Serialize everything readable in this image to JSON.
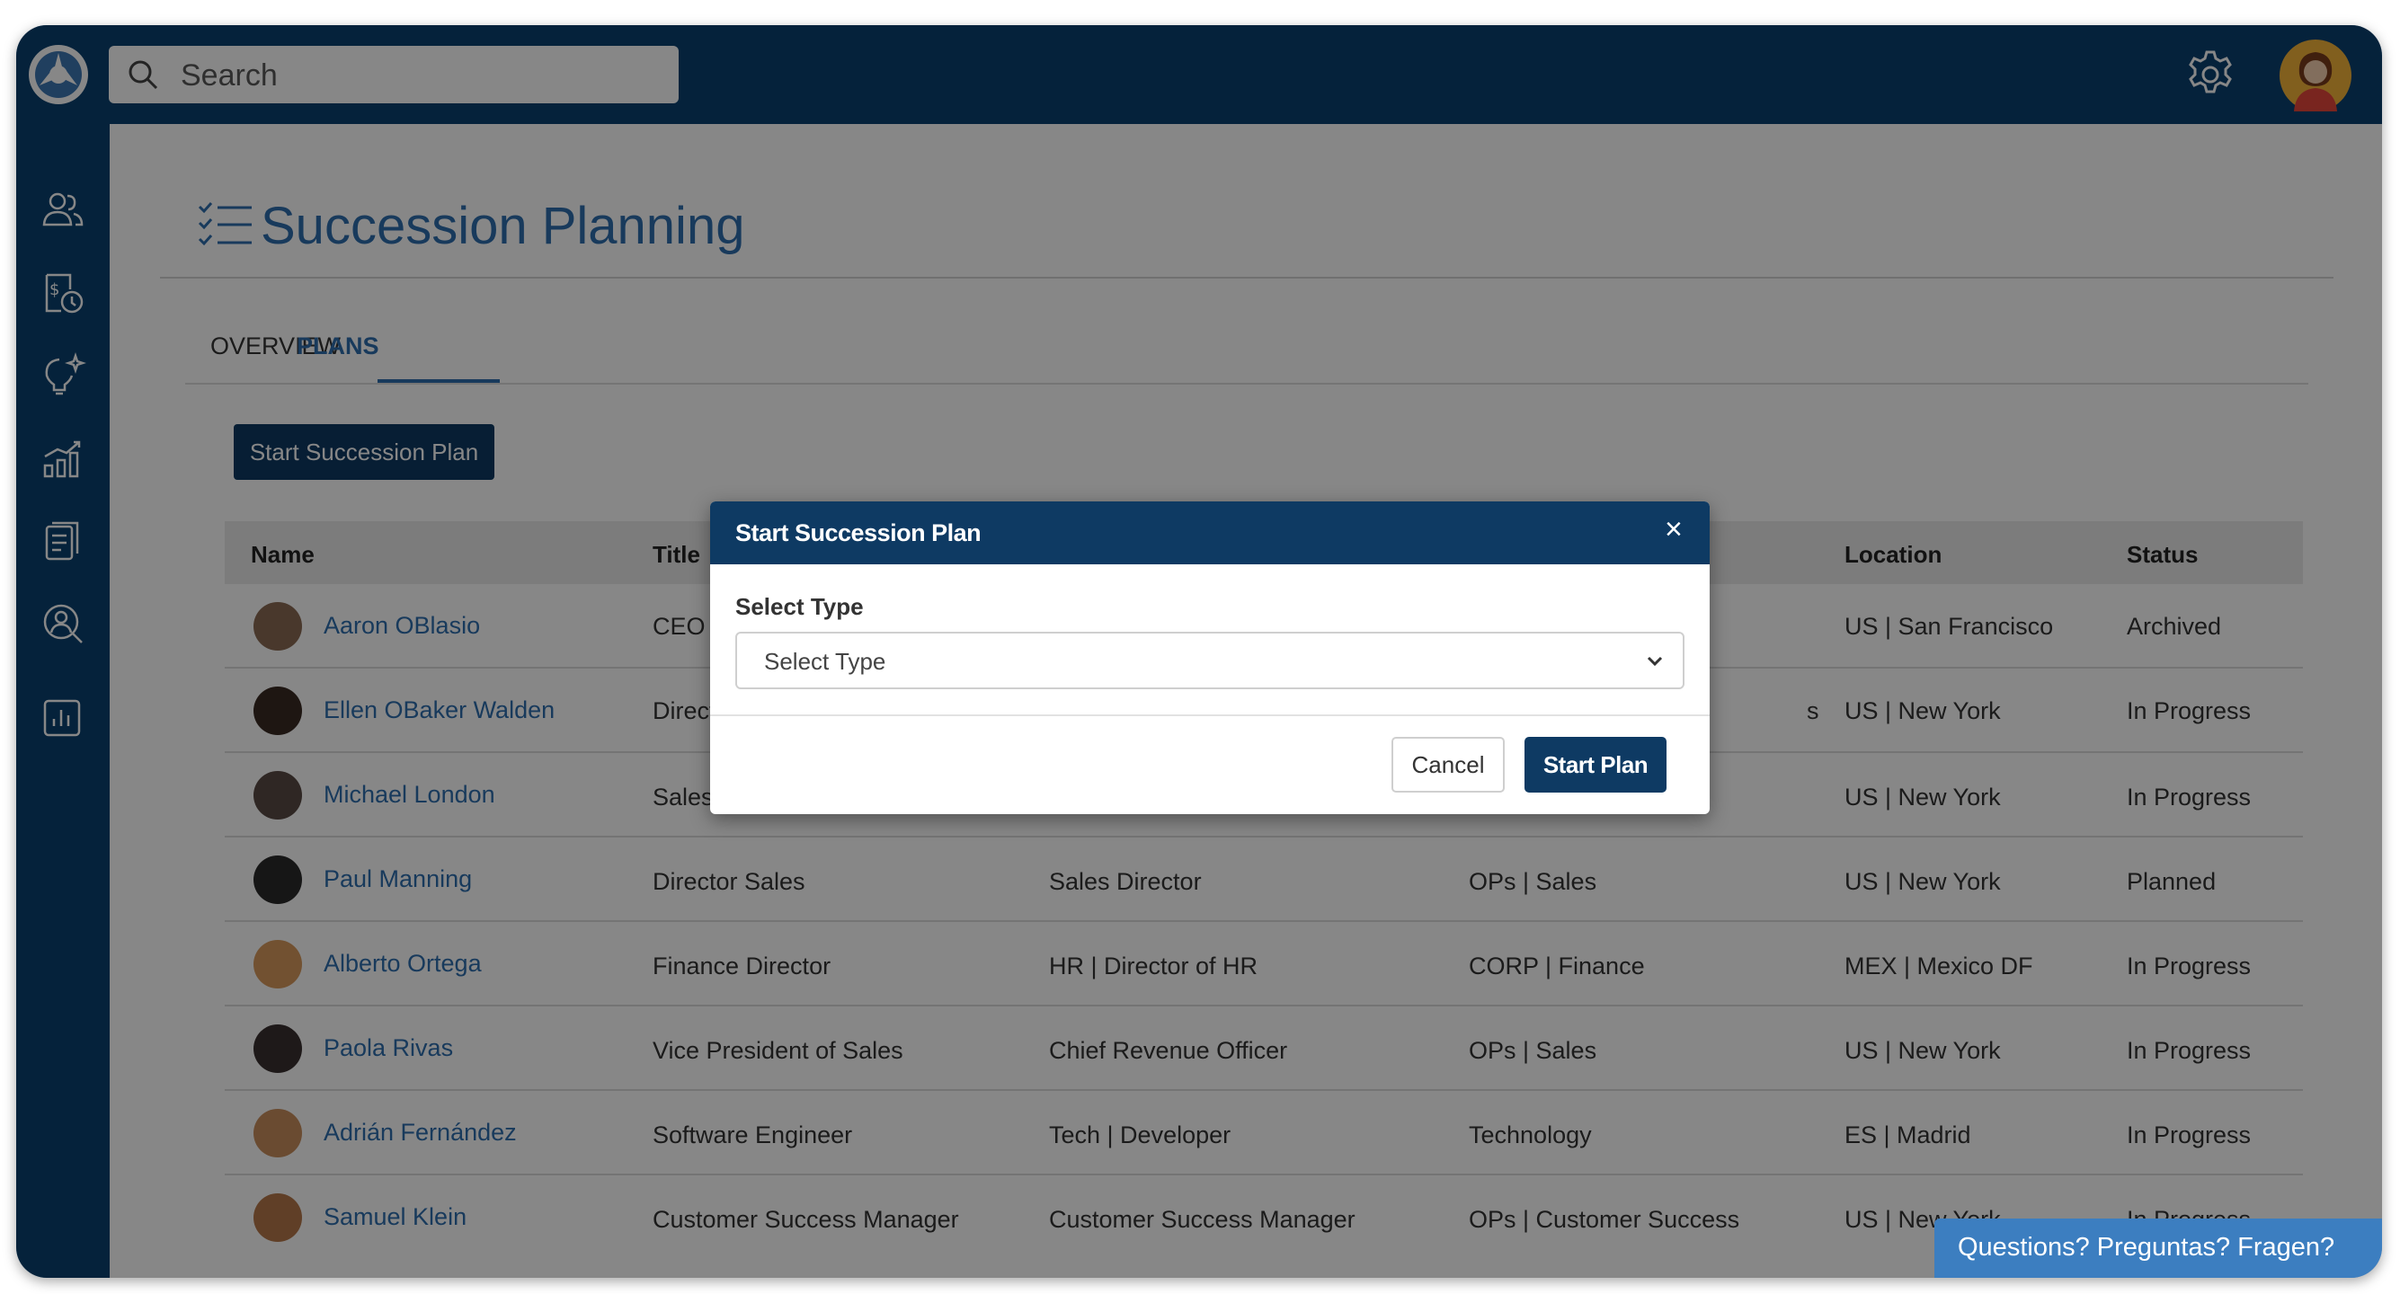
{
  "search": {
    "placeholder": "Search"
  },
  "page": {
    "title": "Succession Planning",
    "tabs": [
      {
        "label": "OVERVIEW",
        "active": false
      },
      {
        "label": "PLANS",
        "active": true
      }
    ],
    "start_button": "Start Succession Plan"
  },
  "table": {
    "columns": [
      "Name",
      "Title",
      "Location",
      "Status"
    ],
    "rows": [
      {
        "name": "Aaron OBlasio",
        "title": "CEO",
        "col3": "",
        "col4": "",
        "location": "US | San Francisco",
        "status": "Archived"
      },
      {
        "name": "Ellen OBaker Walden",
        "title": "Directo",
        "col3": "",
        "col4": "s",
        "location": "US | New York",
        "status": "In Progress"
      },
      {
        "name": "Michael London",
        "title": "Sales A",
        "col3": "",
        "col4": "",
        "location": "US | New York",
        "status": "In Progress"
      },
      {
        "name": "Paul Manning",
        "title": "Director Sales",
        "col3": "Sales Director",
        "col4": "OPs | Sales",
        "location": "US | New York",
        "status": "Planned"
      },
      {
        "name": "Alberto Ortega",
        "title": "Finance Director",
        "col3": "HR | Director of HR",
        "col4": "CORP | Finance",
        "location": "MEX | Mexico DF",
        "status": "In Progress"
      },
      {
        "name": "Paola Rivas",
        "title": "Vice President of Sales",
        "col3": "Chief Revenue Officer",
        "col4": "OPs | Sales",
        "location": "US | New York",
        "status": "In Progress"
      },
      {
        "name": "Adrián Fernández",
        "title": "Software Engineer",
        "col3": "Tech | Developer",
        "col4": "Technology",
        "location": "ES | Madrid",
        "status": "In Progress"
      },
      {
        "name": "Samuel Klein",
        "title": "Customer Success Manager",
        "col3": "Customer Success Manager",
        "col4": "OPs | Customer Success",
        "location": "US | New York",
        "status": "In Progress"
      }
    ]
  },
  "modal": {
    "title": "Start Succession Plan",
    "close": "×",
    "label": "Select Type",
    "select_value": "Select Type",
    "cancel": "Cancel",
    "confirm": "Start Plan"
  },
  "help": "Questions? Preguntas? Fragen?",
  "colors": {
    "nav_bg": "#0a4170",
    "accent": "#2f6fae",
    "primary_button": "#0e3a63",
    "help_bg": "#3c7ec0",
    "avatar_bg": "#f4b33a"
  },
  "icons": {
    "logo": "app-logo",
    "search": "search-icon",
    "settings": "gear-icon",
    "sidebar": [
      "people-icon",
      "compensation-icon",
      "ideas-icon",
      "analytics-icon",
      "documents-icon",
      "talent-search-icon",
      "reports-icon"
    ]
  }
}
